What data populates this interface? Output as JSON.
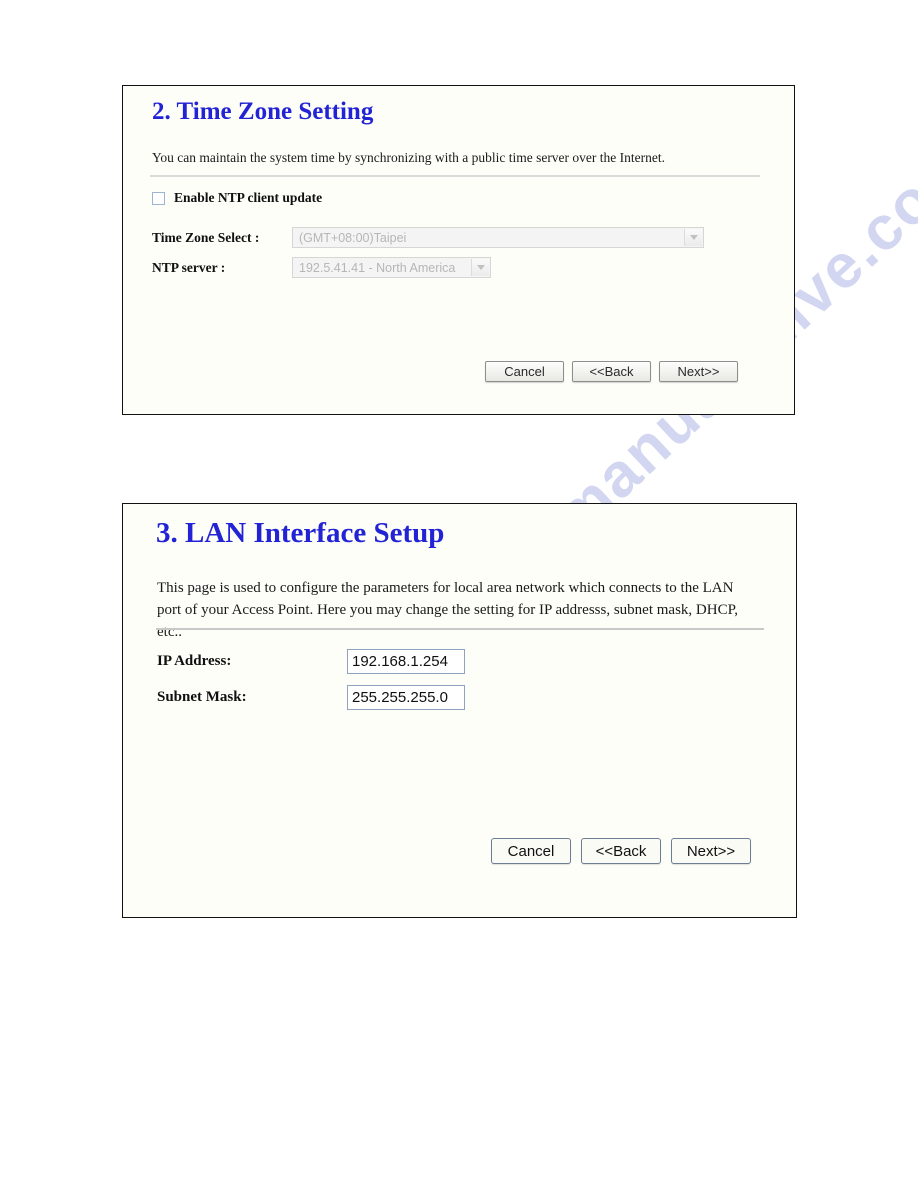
{
  "watermark": {
    "line_1": "manualshive.com",
    "line_2": "manualshive.com",
    "color": "#ccd0ef"
  },
  "panels": [
    {
      "id": "time-zone-setting",
      "title": "2. Time Zone Setting",
      "title_color": "#2323d6",
      "description": "You can maintain the system time by synchronizing with a public time server over the Internet.",
      "checkbox": {
        "label": "Enable NTP client update",
        "checked": false
      },
      "fields": [
        {
          "label": "Time Zone Select :",
          "control": "select",
          "value": "(GMT+08:00)Taipei",
          "disabled": true
        },
        {
          "label": "NTP server :",
          "control": "select",
          "value": "192.5.41.41 - North America",
          "disabled": true
        }
      ],
      "buttons": [
        {
          "label": "Cancel"
        },
        {
          "label": "<<Back"
        },
        {
          "label": "Next>>"
        }
      ]
    },
    {
      "id": "lan-interface-setup",
      "title": "3. LAN Interface Setup",
      "title_color": "#2323d6",
      "description": "This page is used to configure the parameters for local area network which connects to the LAN port of your Access Point. Here you may change the setting for IP addresss, subnet mask, DHCP, etc..",
      "fields": [
        {
          "label": "IP Address:",
          "control": "text",
          "value": "192.168.1.254"
        },
        {
          "label": "Subnet Mask:",
          "control": "text",
          "value": "255.255.255.0"
        }
      ],
      "buttons": [
        {
          "label": "Cancel"
        },
        {
          "label": "<<Back"
        },
        {
          "label": "Next>>"
        }
      ]
    }
  ]
}
